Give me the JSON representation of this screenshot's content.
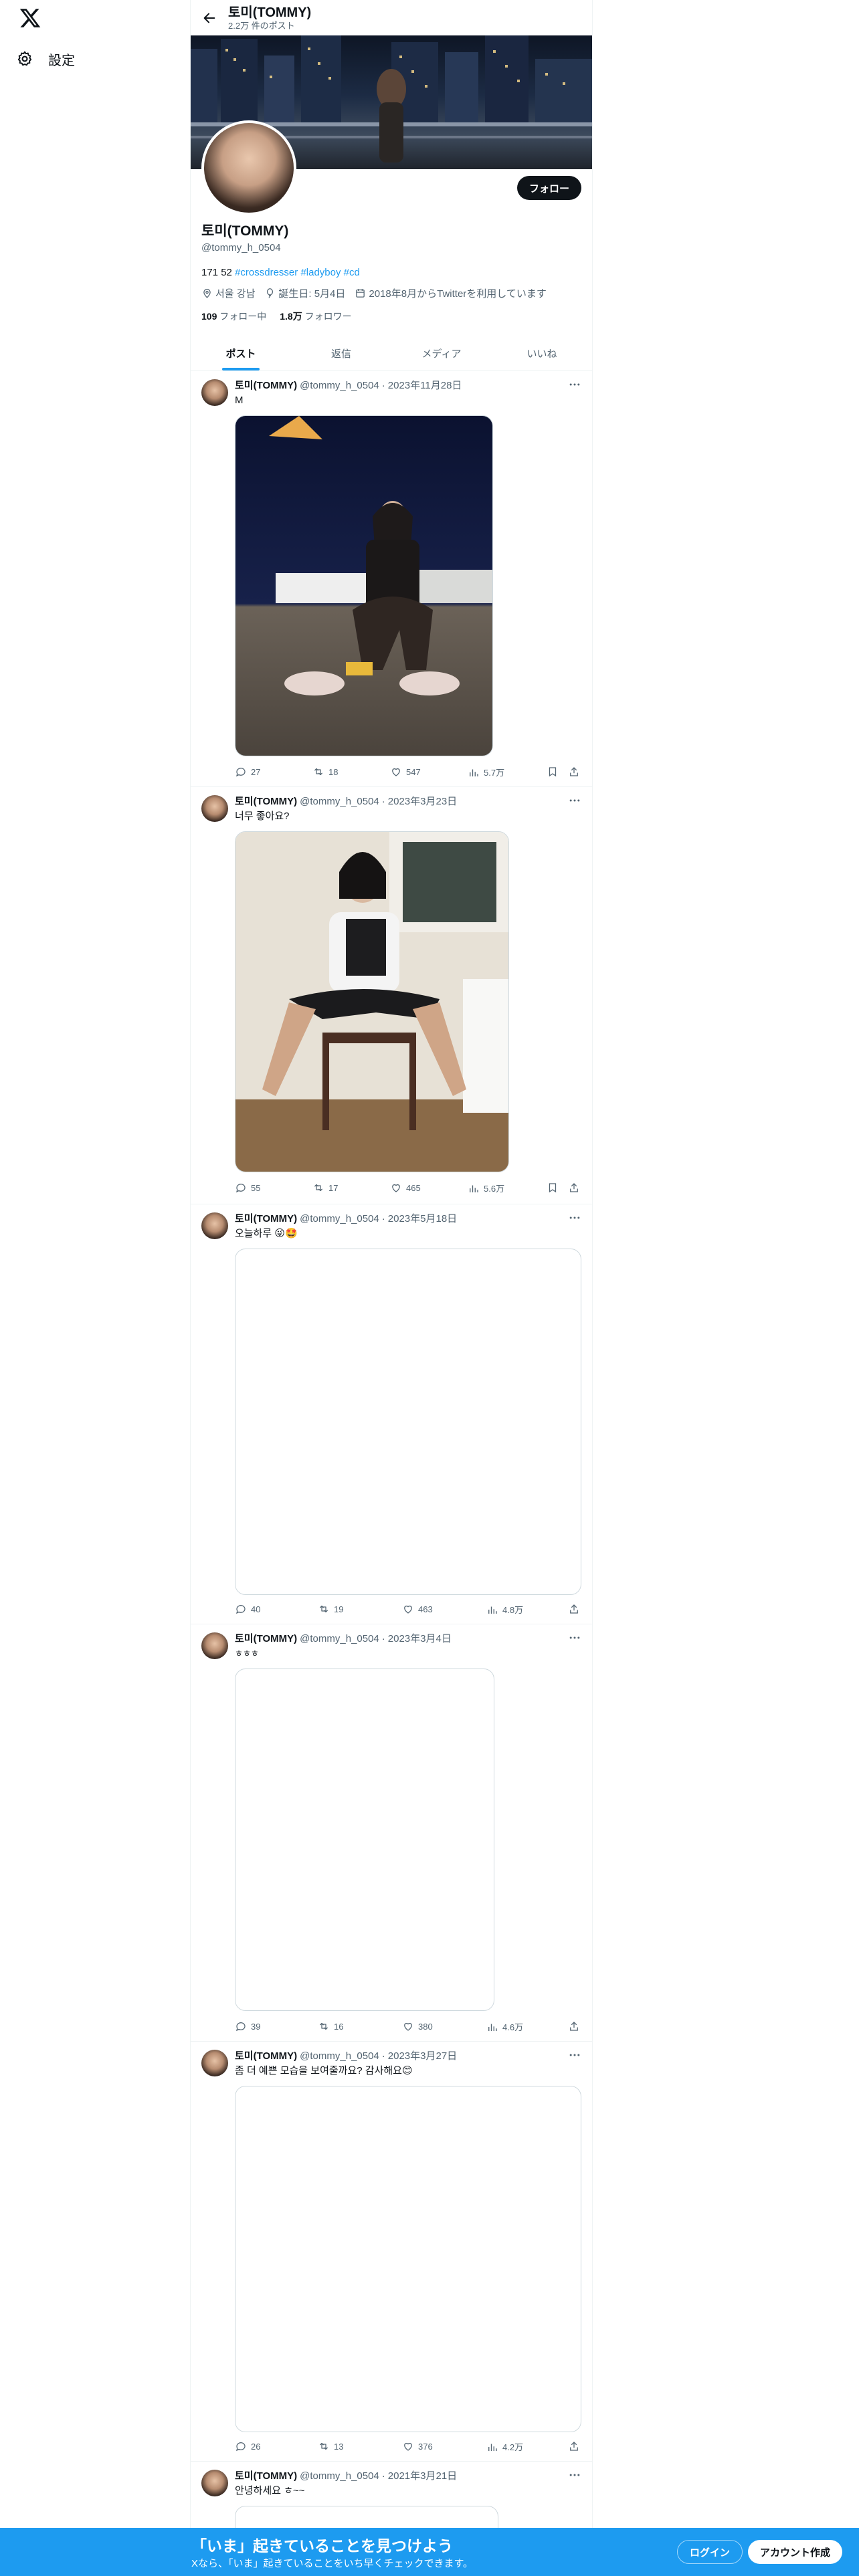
{
  "nav": {
    "settings_label": "設定"
  },
  "header": {
    "name": "토미(TOMMY)",
    "post_count": "2.2万 件のポスト"
  },
  "profile": {
    "name": "토미(TOMMY)",
    "handle": "@tommy_h_0504",
    "follow_label": "フォロー",
    "bio_text": "171 52",
    "bio_tags": [
      "#crossdresser",
      "#ladyboy",
      "#cd"
    ],
    "location": "서울 강남",
    "birthday": "誕生日: 5月4日",
    "joined": "2018年8月からTwitterを利用しています",
    "following_count": "109",
    "following_label": "フォロー中",
    "followers_count": "1.8万",
    "followers_label": "フォロワー"
  },
  "tabs": [
    "ポスト",
    "返信",
    "メディア",
    "いいね"
  ],
  "posts": [
    {
      "name": "토미(TOMMY)",
      "handle": "@tommy_h_0504",
      "dot": "·",
      "date": "2023年11月28日",
      "text": "M",
      "reply": "27",
      "repost": "18",
      "like": "547",
      "views": "5.7万"
    },
    {
      "name": "토미(TOMMY)",
      "handle": "@tommy_h_0504",
      "dot": "·",
      "date": "2023年3月23日",
      "text": "너무 좋아요?",
      "reply": "55",
      "repost": "17",
      "like": "465",
      "views": "5.6万"
    },
    {
      "name": "토미(TOMMY)",
      "handle": "@tommy_h_0504",
      "dot": "·",
      "date": "2023年5月18日",
      "text": "오늘하루 😜🤩",
      "reply": "40",
      "repost": "19",
      "like": "463",
      "views": "4.8万"
    },
    {
      "name": "토미(TOMMY)",
      "handle": "@tommy_h_0504",
      "dot": "·",
      "date": "2023年3月4日",
      "text": "ㅎㅎㅎ",
      "reply": "39",
      "repost": "16",
      "like": "380",
      "views": "4.6万"
    },
    {
      "name": "토미(TOMMY)",
      "handle": "@tommy_h_0504",
      "dot": "·",
      "date": "2023年3月27日",
      "text": "좀 더 예쁜 모습을 보여줄까요? 감사해요😊",
      "reply": "26",
      "repost": "13",
      "like": "376",
      "views": "4.2万"
    },
    {
      "name": "토미(TOMMY)",
      "handle": "@tommy_h_0504",
      "dot": "·",
      "date": "2021年3月21日",
      "text": "안녕하세요 ㅎ~~",
      "reply": "",
      "repost": "",
      "like": "",
      "views": ""
    }
  ],
  "bottom": {
    "title": "「いま」起きていることを見つけよう",
    "subtitle": "Xなら、「いま」起きていることをいち早くチェックできます。",
    "login_label": "ログイン",
    "signup_label": "アカウント作成"
  },
  "colors": {
    "accent": "#1d9bf0",
    "text": "#0f1419",
    "secondary": "#536471"
  }
}
